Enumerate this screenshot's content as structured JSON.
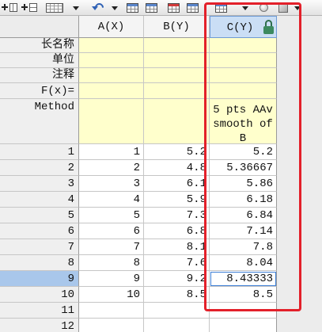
{
  "toolbar": {
    "icons": [
      "add-column-icon",
      "add-row-icon",
      "worksheet-grid-icon",
      "caret-down-icon",
      "undo-icon",
      "caret-down-icon",
      "table-icon",
      "table-icon",
      "colored-table-icon",
      "table-icon",
      "table-icon",
      "caret-down-icon",
      "circle-icon",
      "square-icon",
      "caret-down-icon"
    ]
  },
  "worksheet": {
    "column_headers": [
      "A(X)",
      "B(Y)",
      "C(Y)"
    ],
    "label_rows": [
      {
        "name": "长名称",
        "cells": [
          "",
          "",
          ""
        ]
      },
      {
        "name": "单位",
        "cells": [
          "",
          "",
          ""
        ]
      },
      {
        "name": "注释",
        "cells": [
          "",
          "",
          ""
        ]
      },
      {
        "name": "F(x)=",
        "cells": [
          "",
          "",
          ""
        ]
      },
      {
        "name": "Method",
        "cells": [
          "",
          "",
          "5 pts AAv smooth of B"
        ]
      }
    ],
    "rows": [
      {
        "index": "1",
        "cells": [
          "1",
          "5.2",
          "5.2"
        ]
      },
      {
        "index": "2",
        "cells": [
          "2",
          "4.8",
          "5.36667"
        ]
      },
      {
        "index": "3",
        "cells": [
          "3",
          "6.1",
          "5.86"
        ]
      },
      {
        "index": "4",
        "cells": [
          "4",
          "5.9",
          "6.18"
        ]
      },
      {
        "index": "5",
        "cells": [
          "5",
          "7.3",
          "6.84"
        ]
      },
      {
        "index": "6",
        "cells": [
          "6",
          "6.8",
          "7.14"
        ]
      },
      {
        "index": "7",
        "cells": [
          "7",
          "8.1",
          "7.8"
        ]
      },
      {
        "index": "8",
        "cells": [
          "8",
          "7.6",
          "8.04"
        ]
      },
      {
        "index": "9",
        "cells": [
          "9",
          "9.2",
          "8.43333"
        ]
      },
      {
        "index": "10",
        "cells": [
          "10",
          "8.5",
          "8.5"
        ]
      },
      {
        "index": "11",
        "cells": [
          "",
          "",
          ""
        ]
      },
      {
        "index": "12",
        "cells": [
          "",
          "",
          ""
        ]
      }
    ]
  },
  "colors": {
    "annotation_red": "#e3202a",
    "label_row_yellow": "#ffffcc",
    "selected_row_blue": "#a9c7eb",
    "selected_column_header_blue": "#cadef5",
    "active_cell_border": "#3d7fd6",
    "lock_green": "#3c8a60"
  }
}
